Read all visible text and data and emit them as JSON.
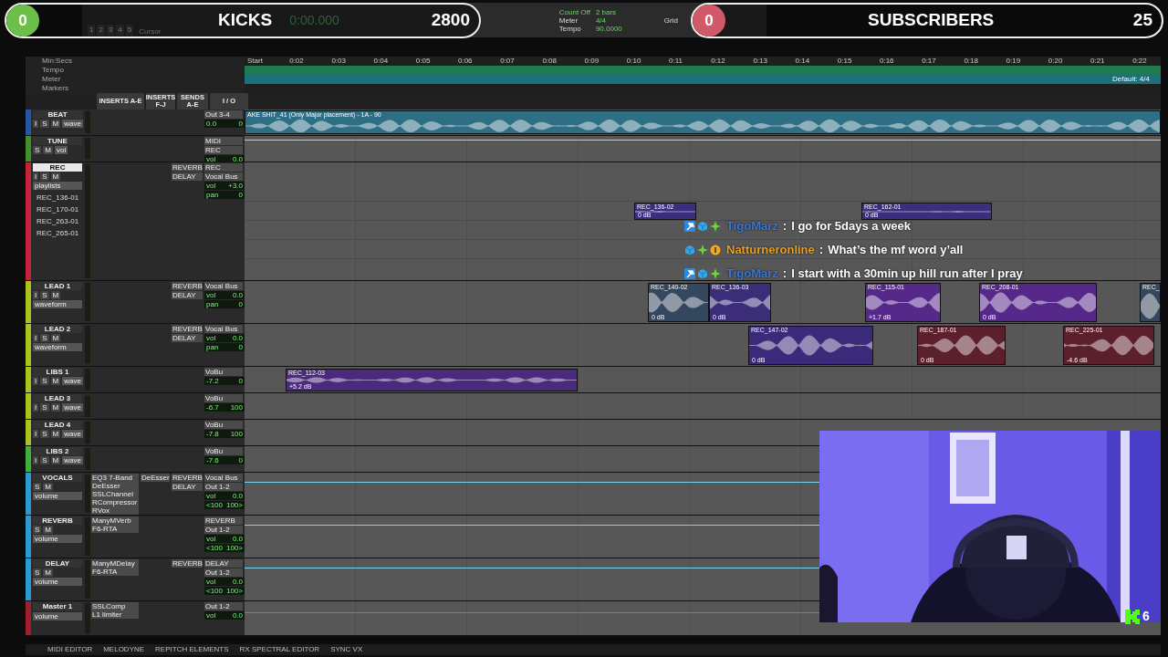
{
  "stream_overlay": {
    "left_counter": {
      "value": "0",
      "level": 0,
      "label": "KICKS",
      "goal": "2800"
    },
    "right_counter": {
      "value": "0",
      "level": 0,
      "label": "SUBSCRIBERS",
      "goal": "25"
    }
  },
  "toolbar": {
    "edit_groups": [
      "1",
      "2",
      "3",
      "4",
      "5"
    ],
    "counter": "0:00.000",
    "cursor_label": "Cursor",
    "count_off": "Count Off",
    "meter_label": "Meter",
    "tempo_label": "Tempo",
    "bars": "2 bars",
    "meter": "4/4",
    "tempo": "90.0000",
    "grid_label": "Grid"
  },
  "rulers": {
    "labels": [
      "Min:Secs",
      "Tempo",
      "Meter",
      "Markers"
    ],
    "ticks": [
      "Start",
      "0:02",
      "0:03",
      "0:04",
      "0:05",
      "0:06",
      "0:07",
      "0:08",
      "0:09",
      "0:10",
      "0:11",
      "0:12",
      "0:13",
      "0:14",
      "0:15",
      "0:16",
      "0:17",
      "0:18",
      "0:19",
      "0:20",
      "0:21",
      "0:22"
    ],
    "meter_default": "Default: 4/4"
  },
  "columns": [
    "INSERTS A-E",
    "INSERTS F-J",
    "SENDS A-E",
    "I / O"
  ],
  "tracks": [
    {
      "name": "BEAT",
      "color": "#2456a8",
      "kind": "mini",
      "buttons": [
        "I",
        "S",
        "M"
      ],
      "view": "wave",
      "io": [
        "Out 3-4"
      ],
      "volume": {
        "value": "0.0"
      },
      "pan": {
        "value": "0"
      },
      "clips": [
        {
          "name": "AKE SHIT_41 (Only Major placement) - 1A - 90",
          "color": "#2f6f86"
        }
      ]
    },
    {
      "name": "TUNE",
      "color": "#3f8f2a",
      "kind": "mini",
      "buttons": [
        "S",
        "M"
      ],
      "view": "vol",
      "io": [
        "MIDI",
        "REC"
      ],
      "volume": {
        "label": "vol",
        "value": "0.0"
      }
    },
    {
      "name": "REC",
      "color": "#c4243a",
      "kind": "playlists",
      "buttons": [
        "I",
        "S",
        "M"
      ],
      "view": "playlists",
      "sends": [
        "REVERB",
        "DELAY"
      ],
      "io": [
        "REC",
        "Vocal Bus"
      ],
      "volume": {
        "label": "vol",
        "value": "+3.0"
      },
      "pan": {
        "label": "pan",
        "value": "0"
      },
      "playlists": [
        {
          "name": "REC_136-01",
          "clips": [
            {
              "name": "REC_136-02",
              "gain": "0 dB",
              "color": "#3a2f7e"
            },
            {
              "name": "REC_162-01",
              "gain": "0 dB",
              "color": "#3a2f7e"
            }
          ]
        },
        {
          "name": "REC_170-01"
        },
        {
          "name": "REC_263-01"
        },
        {
          "name": "REC_265-01"
        }
      ]
    },
    {
      "name": "LEAD 1",
      "color": "#a9c21e",
      "kind": "full",
      "buttons": [
        "I",
        "S",
        "M"
      ],
      "view": "waveform",
      "sends": [
        "REVERB",
        "DELAY"
      ],
      "io": [
        "Vocal Bus"
      ],
      "volume": {
        "label": "vol",
        "value": "0.0"
      },
      "pan": {
        "label": "pan",
        "value": "0"
      },
      "clips": [
        {
          "name": "REC_140-02",
          "gain": "0 dB",
          "color": "#33475e"
        },
        {
          "name": "REC_136-03",
          "gain": "0 dB",
          "color": "#3b2d78"
        },
        {
          "name": "REC_115-01",
          "gain": "+1.7 dB",
          "color": "#55288a"
        },
        {
          "name": "REC_208-01",
          "gain": "0 dB",
          "color": "#55288a"
        },
        {
          "name": "REC_",
          "color": "#33475e"
        }
      ]
    },
    {
      "name": "LEAD 2",
      "color": "#a9c21e",
      "kind": "full",
      "buttons": [
        "I",
        "S",
        "M"
      ],
      "view": "waveform",
      "sends": [
        "REVERB",
        "DELAY"
      ],
      "io": [
        "Vocal Bus"
      ],
      "volume": {
        "label": "vol",
        "value": "0.0"
      },
      "pan": {
        "label": "pan",
        "value": "0"
      },
      "clips": [
        {
          "name": "REC_147-02",
          "gain": "0 dB",
          "color": "#3b2a7a"
        },
        {
          "name": "REC_187-01",
          "gain": "0 dB",
          "color": "#5c1f2c"
        },
        {
          "name": "REC_225-01",
          "gain": "-4.6 dB",
          "color": "#5c1f2c"
        }
      ]
    },
    {
      "name": "LIBS 1",
      "color": "#a9c21e",
      "kind": "mini",
      "buttons": [
        "I",
        "S",
        "M"
      ],
      "view": "wave",
      "io": [
        "VoBu"
      ],
      "volume": {
        "value": "-7.2"
      },
      "pan": {
        "value": "0"
      },
      "clips": [
        {
          "name": "REC_112-03",
          "gain": "+5.2 dB",
          "color": "#4a2a7c"
        }
      ]
    },
    {
      "name": "LEAD 3",
      "color": "#a9c21e",
      "kind": "mini",
      "buttons": [
        "I",
        "S",
        "M"
      ],
      "view": "wave",
      "io": [
        "VoBu"
      ],
      "volume": {
        "value": "-6.7"
      },
      "pan": {
        "value": "100"
      }
    },
    {
      "name": "LEAD 4",
      "color": "#a9c21e",
      "kind": "mini",
      "buttons": [
        "I",
        "S",
        "M"
      ],
      "view": "wave",
      "io": [
        "VoBu"
      ],
      "volume": {
        "value": "-7.8"
      },
      "pan": {
        "value": "100"
      }
    },
    {
      "name": "LIBS 2",
      "color": "#3fb03a",
      "kind": "mini",
      "buttons": [
        "I",
        "S",
        "M"
      ],
      "view": "wave",
      "io": [
        "VoBu"
      ],
      "volume": {
        "value": "-7.6"
      },
      "pan": {
        "value": "0"
      }
    },
    {
      "name": "VOCALS",
      "color": "#2a9ad4",
      "kind": "full",
      "buttons": [
        "S",
        "M"
      ],
      "view": "volume",
      "inserts": [
        "EQ3 7-Band",
        "DeEsser",
        "SSLChannel",
        "RCompressor",
        "RVox"
      ],
      "inserts_fj": [
        "DeEsser"
      ],
      "sends": [
        "REVERB",
        "DELAY"
      ],
      "io": [
        "Vocal Bus",
        "Out 1-2"
      ],
      "volume": {
        "label": "vol",
        "value": "0.0"
      },
      "pan": {
        "label": "<100",
        "value": "100>"
      },
      "automation_line": true
    },
    {
      "name": "REVERB",
      "color": "#2a9ad4",
      "kind": "full",
      "buttons": [
        "S",
        "M"
      ],
      "view": "volume",
      "inserts": [
        "ManyMVerb",
        "F6-RTA"
      ],
      "io": [
        "REVERB",
        "Out 1-2"
      ],
      "volume": {
        "label": "vol",
        "value": "0.0"
      },
      "pan": {
        "label": "<100",
        "value": "100>"
      },
      "automation_line": true
    },
    {
      "name": "DELAY",
      "color": "#2a9ad4",
      "kind": "full",
      "buttons": [
        "S",
        "M"
      ],
      "view": "volume",
      "inserts": [
        "ManyMDelay",
        "F6-RTA"
      ],
      "sends": [
        "REVERB"
      ],
      "io": [
        "DELAY",
        "Out 1-2"
      ],
      "volume": {
        "label": "vol",
        "value": "0.0"
      },
      "pan": {
        "label": "<100",
        "value": "100>"
      },
      "automation_line": true
    },
    {
      "name": "Master 1",
      "color": "#a01f2c",
      "kind": "master",
      "view": "volume",
      "inserts": [
        "SSLComp",
        "L1 limiter"
      ],
      "io": [
        "Out 1-2"
      ],
      "volume": {
        "label": "vol",
        "value": "0.0"
      },
      "automation_line": true
    }
  ],
  "chat": [
    {
      "user": "TigoMarz",
      "color": "#3a78d8",
      "badges": [
        {
          "kind": "moderator"
        },
        {
          "kind": "subscriber"
        },
        {
          "kind": "gifter"
        }
      ],
      "separator": ":",
      "text": "I go for 5days a week"
    },
    {
      "user": "Natturneronline",
      "color": "#e8a020",
      "badges": [
        {
          "kind": "subscriber"
        },
        {
          "kind": "gifter"
        },
        {
          "kind": "first"
        }
      ],
      "separator": ":",
      "text": "What’s the mf word y’all"
    },
    {
      "user": "TigoMarz",
      "color": "#3a78d8",
      "badges": [
        {
          "kind": "moderator"
        },
        {
          "kind": "subscriber"
        },
        {
          "kind": "gifter"
        }
      ],
      "separator": ":",
      "text": "I start with a 30min up hill run after I pray"
    }
  ],
  "webcam": {
    "kind": "picture",
    "viewers": "6"
  },
  "bottom_tabs": [
    "MIDI EDITOR",
    "MELODYNE",
    "REPITCH ELEMENTS",
    "RX SPECTRAL EDITOR",
    "SYNC VX"
  ]
}
